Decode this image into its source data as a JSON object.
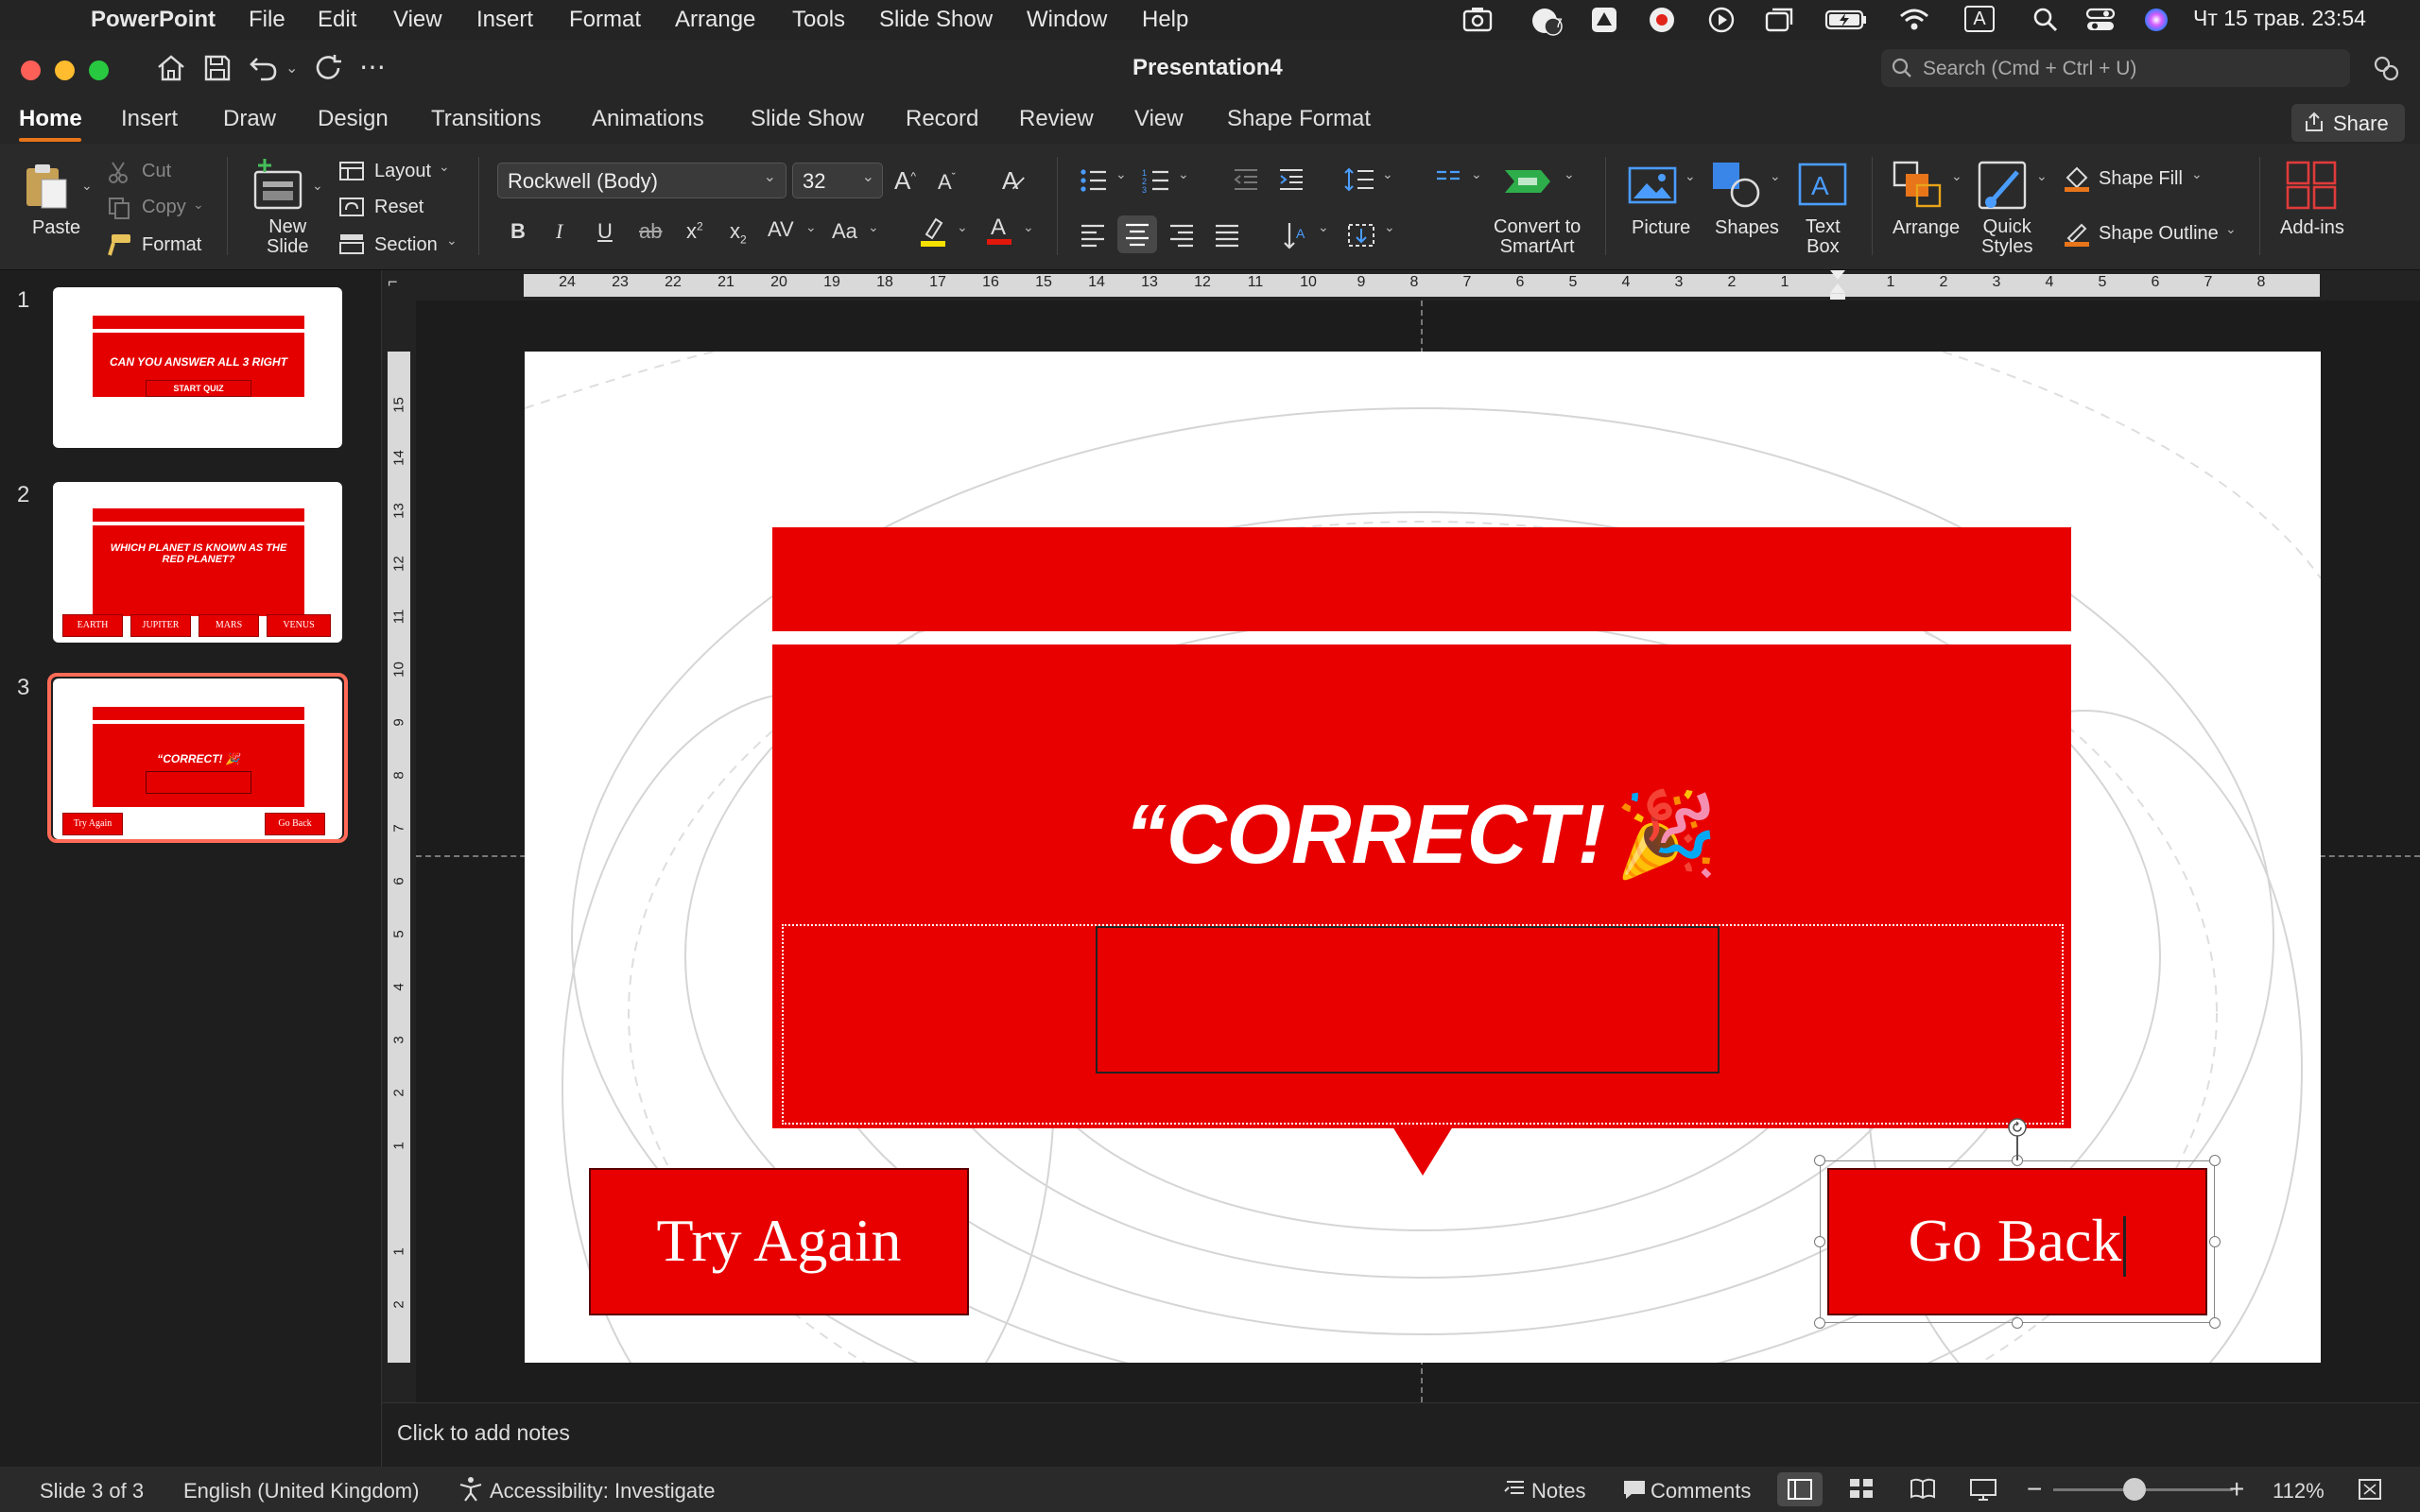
{
  "menubar": {
    "app_name": "PowerPoint",
    "items": [
      "File",
      "Edit",
      "View",
      "Insert",
      "Format",
      "Arrange",
      "Tools",
      "Slide Show",
      "Window",
      "Help"
    ],
    "clock": "Чт 15 трав.  23:54",
    "input_source": "A",
    "badge": "7"
  },
  "window": {
    "title": "Presentation4",
    "search_placeholder": "Search (Cmd + Ctrl + U)"
  },
  "tabs": [
    "Home",
    "Insert",
    "Draw",
    "Design",
    "Transitions",
    "Animations",
    "Slide Show",
    "Record",
    "Review",
    "View",
    "Shape Format"
  ],
  "active_tab": "Home",
  "share_label": "Share",
  "ribbon": {
    "paste": "Paste",
    "cut": "Cut",
    "copy": "Copy",
    "format": "Format",
    "new_slide": [
      "New",
      "Slide"
    ],
    "layout": "Layout",
    "reset": "Reset",
    "section": "Section",
    "font_name": "Rockwell (Body)",
    "font_size": "32",
    "convert_smartart": [
      "Convert to",
      "SmartArt"
    ],
    "picture": "Picture",
    "shapes": "Shapes",
    "text_box": [
      "Text",
      "Box"
    ],
    "arrange": "Arrange",
    "quick_styles": [
      "Quick",
      "Styles"
    ],
    "shape_fill": "Shape Fill",
    "shape_outline": "Shape Outline",
    "add_ins": "Add-ins"
  },
  "thumbnails": [
    {
      "num": "1",
      "title": "CAN YOU ANSWER ALL 3 RIGHT",
      "button": "START QUIZ"
    },
    {
      "num": "2",
      "title": "WHICH PLANET IS KNOWN AS THE RED PLANET?",
      "options": [
        "EARTH",
        "JUPITER",
        "MARS",
        "VENUS"
      ]
    },
    {
      "num": "3",
      "title": "“CORRECT! 🎉",
      "buttons": [
        "Try Again",
        "Go Back"
      ]
    }
  ],
  "slide": {
    "headline": "“CORRECT!",
    "emoji": "🎉",
    "try_again": "Try Again",
    "go_back": "Go Back"
  },
  "ruler": {
    "h_left": [
      "24",
      "23",
      "22",
      "21",
      "20",
      "19",
      "18",
      "17",
      "16",
      "15",
      "14",
      "13",
      "12",
      "11",
      "10",
      "9",
      "8",
      "7",
      "6",
      "5",
      "4",
      "3",
      "2",
      "1"
    ],
    "h_right": [
      "1",
      "2",
      "3",
      "4",
      "5",
      "6",
      "7",
      "8"
    ],
    "v_top": [
      "15",
      "14",
      "13",
      "12",
      "11",
      "10",
      "9",
      "8",
      "7",
      "6",
      "5",
      "4",
      "3",
      "2",
      "1"
    ],
    "v_bottom": [
      "1",
      "2"
    ]
  },
  "notes_placeholder": "Click to add notes",
  "status": {
    "slide_of": "Slide 3 of 3",
    "language": "English (United Kingdom)",
    "accessibility": "Accessibility: Investigate",
    "notes": "Notes",
    "comments": "Comments",
    "zoom": "112%"
  },
  "colors": {
    "slide_red": "#e80000",
    "selection_border": "#ff6b57",
    "accent_orange": "#e8751a"
  }
}
